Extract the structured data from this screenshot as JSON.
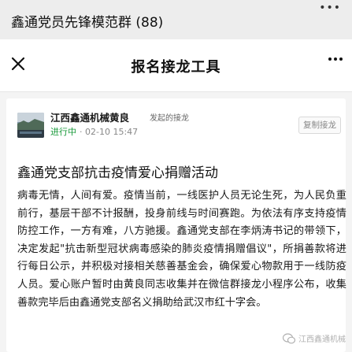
{
  "chat": {
    "title": "鑫通党员先锋模范群 (88)",
    "more_icon": "more-dots-icon"
  },
  "miniprogram": {
    "title": "报名接龙工具",
    "close_icon": "close-icon",
    "more_icon": "more-dots-icon"
  },
  "post": {
    "author": "江西鑫通机械黄良",
    "initiated_label": "发起的接龙",
    "status": "进行中",
    "date": "· 02-10 15:47",
    "copy_button": "复制接龙",
    "title": "鑫通党支部抗击疫情爱心捐赠活动",
    "body": "病毒无情，人间有爱。疫情当前，一线医护人员无论生死，为人民负重前行，基层干部不计报酬，投身前线与时间赛跑。为依法有序支持疫情防控工作，一方有难，八方驰援。鑫通党支部在李炳涛书记的带领下，决定发起\"抗击新型冠状病毒感染的肺炎疫情捐赠倡议\"，所捐善款将进行每日公示，并积极对接相关慈善基金会，确保爱心物款用于一线防疫人员。爱心账户暂时由黄良同志收集并在微信群接龙小程序公布，收集善款完毕后由鑫通党支部名义捐助给武汉市红十字会。"
  },
  "watermark": {
    "text": "江西鑫通机械"
  },
  "colors": {
    "status_green": "#1a9a3b",
    "header_bg": "#ededed",
    "card_bg": "#f4f4f4"
  }
}
